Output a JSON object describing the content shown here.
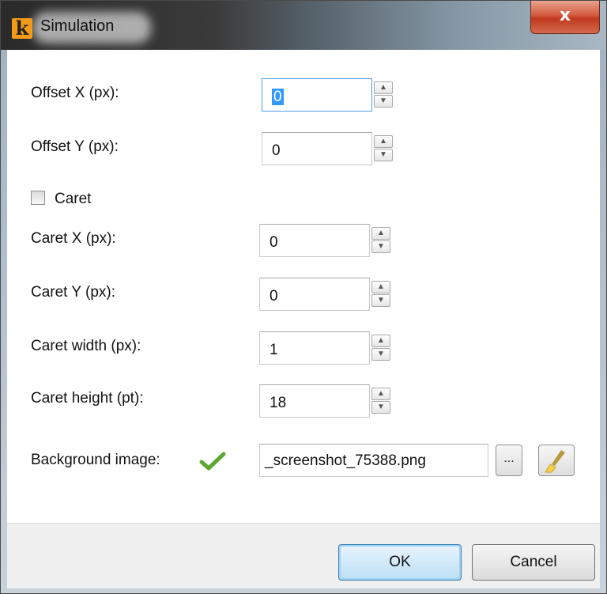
{
  "window": {
    "title": "Simulation",
    "logo_letter": "k",
    "close_glyph": "x"
  },
  "fields": {
    "offset_x": {
      "label": "Offset X (px):",
      "value": "0"
    },
    "offset_y": {
      "label": "Offset Y (px):",
      "value": "0"
    },
    "caret": {
      "label": "Caret",
      "checked": false
    },
    "caret_x": {
      "label": "Caret X (px):",
      "value": "0"
    },
    "caret_y": {
      "label": "Caret Y (px):",
      "value": "0"
    },
    "caret_width": {
      "label": "Caret width (px):",
      "value": "1"
    },
    "caret_height": {
      "label": "Caret height (pt):",
      "value": "18"
    },
    "background_image": {
      "label": "Background image:",
      "value": "_screenshot_75388.png",
      "status_icon": "check-icon"
    }
  },
  "buttons": {
    "browse_label": "...",
    "ok_label": "OK",
    "cancel_label": "Cancel",
    "clear_icon": "brush-icon"
  },
  "colors": {
    "selection": "#3399ff",
    "check_green": "#5aa832",
    "logo_orange": "#f29a1a",
    "close_red": "#c7432a"
  }
}
